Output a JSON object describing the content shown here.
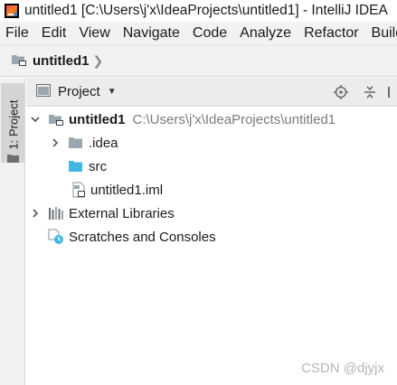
{
  "titlebar": {
    "text": "untitled1 [C:\\Users\\j'x\\IdeaProjects\\untitled1] - IntelliJ IDEA"
  },
  "menu": {
    "items": [
      "File",
      "Edit",
      "View",
      "Navigate",
      "Code",
      "Analyze",
      "Refactor",
      "Build"
    ]
  },
  "navbar": {
    "project_name": "untitled1"
  },
  "stripe": {
    "project_tab_label": "1: Project"
  },
  "toolwindow": {
    "view_selector_label": "Project"
  },
  "tree": {
    "root_label": "untitled1",
    "root_path": "C:\\Users\\j'x\\IdeaProjects\\untitled1",
    "idea_label": ".idea",
    "src_label": "src",
    "iml_label": "untitled1.iml",
    "ext_libs_label": "External Libraries",
    "scratches_label": "Scratches and Consoles"
  },
  "watermark": {
    "text": "CSDN @djyjx"
  },
  "colors": {
    "folder": "#9aa7b0",
    "folder_blue": "#40b6e0",
    "chrome_bg": "#f2f2f2"
  }
}
